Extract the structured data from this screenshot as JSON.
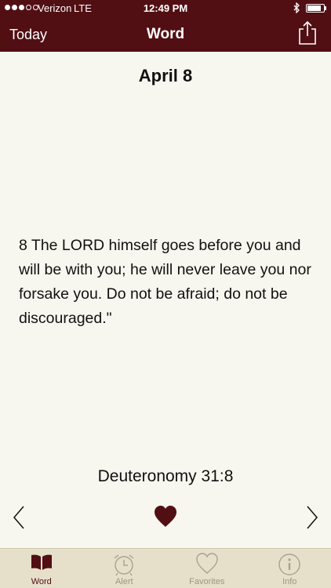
{
  "status_bar": {
    "carrier": "Verizon",
    "network": "LTE",
    "time": "12:49 PM",
    "signal_bars": 3,
    "signal_total": 5,
    "battery_level": 0.85
  },
  "nav": {
    "left_label": "Today",
    "title": "Word"
  },
  "content": {
    "date": "April 8",
    "verse": "8 The LORD himself goes before you and will be with you; he will never leave you nor forsake you. Do not be afraid; do not be discouraged.\"",
    "reference": "Deuteronomy 31:8",
    "favorited": true
  },
  "tabs": [
    {
      "label": "Word",
      "icon": "book-icon",
      "active": true
    },
    {
      "label": "Alert",
      "icon": "alarm-clock-icon",
      "active": false
    },
    {
      "label": "Favorites",
      "icon": "heart-outline-icon",
      "active": false
    },
    {
      "label": "Info",
      "icon": "info-icon",
      "active": false
    }
  ],
  "colors": {
    "brand": "#510f14",
    "background": "#f7f6ef",
    "tabbar": "#e6dfca",
    "inactive_tab": "#9b9585"
  }
}
